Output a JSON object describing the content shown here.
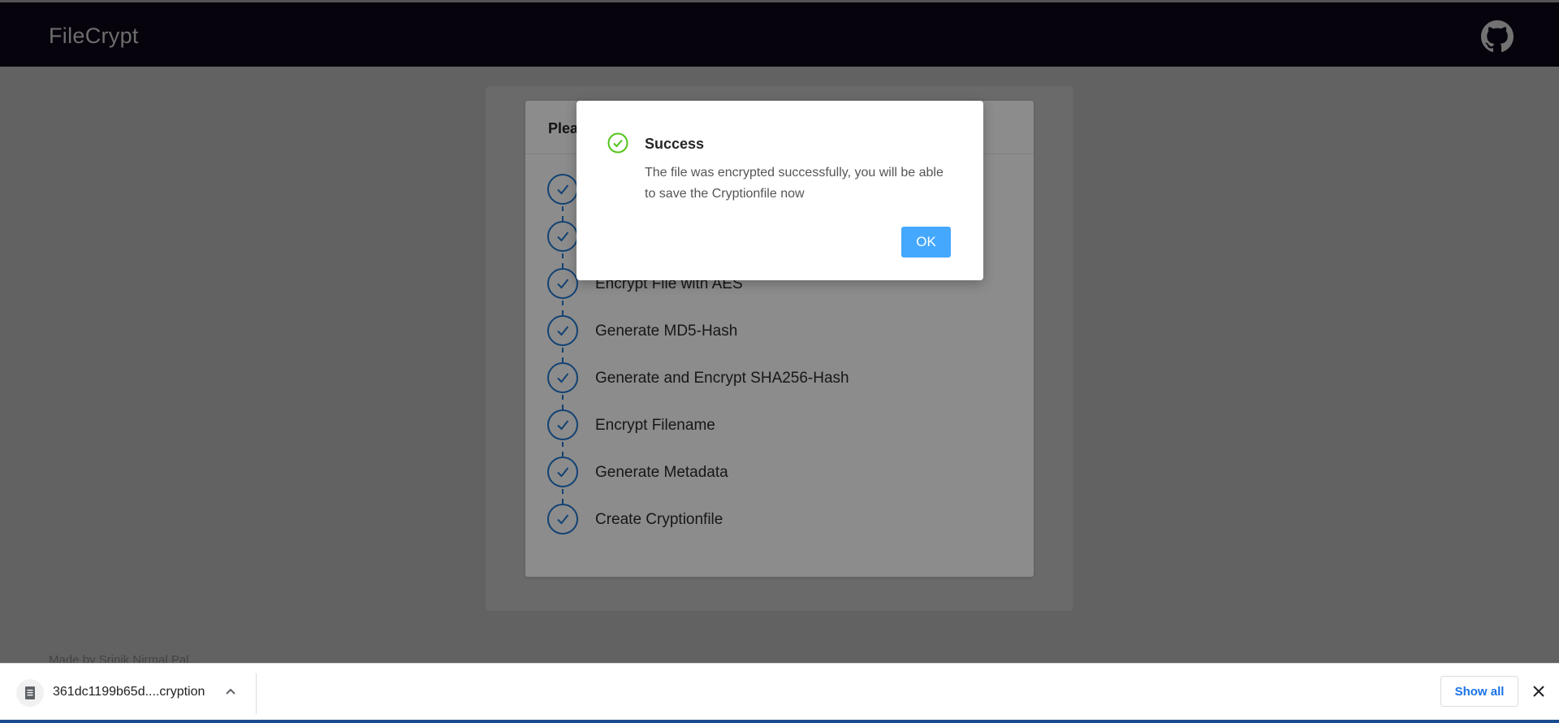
{
  "app": {
    "brand": "FileCrypt"
  },
  "card": {
    "header": "Plea",
    "steps": [
      {
        "label": ""
      },
      {
        "label": ""
      },
      {
        "label": "Encrypt File with AES"
      },
      {
        "label": "Generate MD5-Hash"
      },
      {
        "label": "Generate and Encrypt SHA256-Hash"
      },
      {
        "label": "Encrypt Filename"
      },
      {
        "label": "Generate Metadata"
      },
      {
        "label": "Create Cryptionfile"
      }
    ]
  },
  "footer": {
    "text": "Made by Srinik Nirmal Pal..."
  },
  "modal": {
    "title": "Success",
    "message": "The file was encrypted successfully, you will be able to save the Cryptionfile now",
    "ok_label": "OK",
    "icon": "check-circle-icon",
    "accent": "#52c41a"
  },
  "downloads": {
    "filename": "361dc1199b65d....cryption",
    "show_all_label": "Show all"
  },
  "colors": {
    "navbar": "#0d0717",
    "step_accent": "#1f78d1",
    "ok_button": "#45a8ff",
    "link": "#1a73e8"
  }
}
